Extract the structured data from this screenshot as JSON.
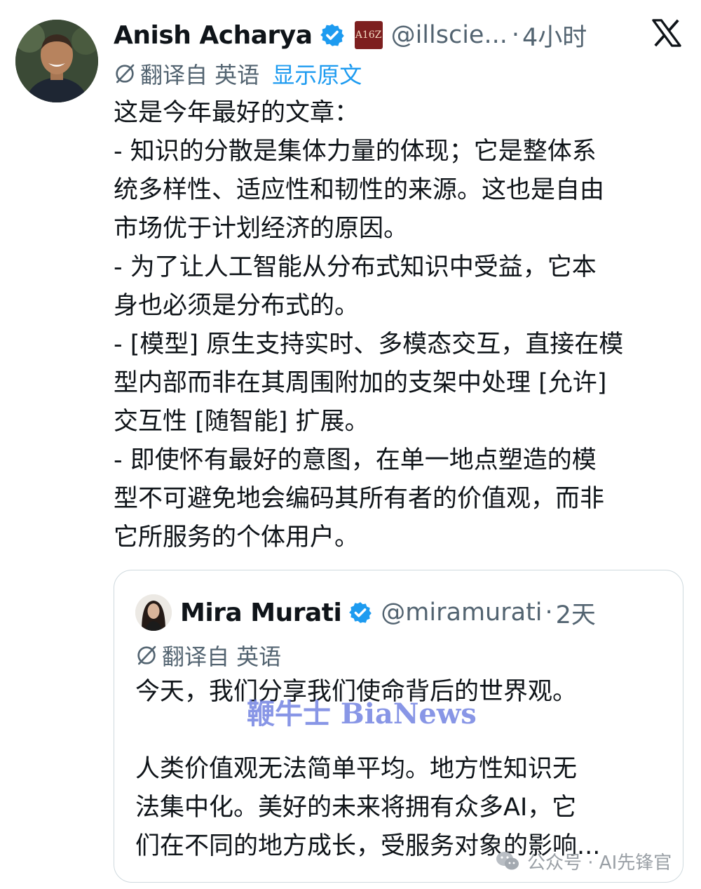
{
  "tweet": {
    "author_name": "Anish Acharya",
    "affiliation_badge": "A16Z",
    "handle": "@illscie...",
    "separator": "·",
    "time": "4小时",
    "translated_from": "翻译自 英语",
    "show_original": "显示原文",
    "body_lines": [
      "这是今年最好的文章：",
      "- 知识的分散是集体力量的体现；它是整体系",
      "统多样性、适应性和韧性的来源。这也是自由",
      "市场优于计划经济的原因。",
      "- 为了让人工智能从分布式知识中受益，它本",
      "身也必须是分布式的。",
      "- [模型] 原生支持实时、多模态交互，直接在模",
      "型内部而非在其周围附加的支架中处理 [允许]",
      "交互性 [随智能] 扩展。",
      "- 即使怀有最好的意图，在单一地点塑造的模",
      "型不可避免地会编码其所有者的价值观，而非",
      "它所服务的个体用户。"
    ]
  },
  "quoted_tweet": {
    "author_name": "Mira Murati",
    "handle": "@miramurati",
    "separator": "·",
    "time": "2天",
    "translated_from": "翻译自 英语",
    "line1": "今天，我们分享我们使命背后的世界观。",
    "body_lines": [
      "人类价值观无法简单平均。地方性知识无",
      "法集中化。美好的未来将拥有众多AI，它",
      "们在不同的地方成长，受服务对象的影响..."
    ]
  },
  "watermark": "鞭牛士 BiaNews",
  "wechat_mark": "公众号 · AI先锋官",
  "colors": {
    "text": "#0f1419",
    "muted": "#536471",
    "link": "#1d9bf0",
    "verified": "#1d9bf0",
    "border": "#cfd9de"
  },
  "icons": [
    "verified-badge-icon",
    "x-logo-icon",
    "translate-icon",
    "wechat-icon"
  ]
}
